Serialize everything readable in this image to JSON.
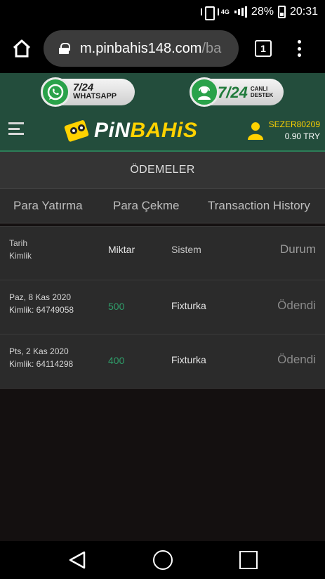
{
  "status_bar": {
    "network": "4G",
    "battery": "28%",
    "time": "20:31"
  },
  "browser": {
    "url_main": "m.pinbahis148.com",
    "url_rest": "/ba",
    "tab_count": "1"
  },
  "header": {
    "whatsapp": {
      "big": "7/24",
      "small": "WHATSAPP"
    },
    "live_support": {
      "big": "7/24",
      "line1": "CANLI",
      "line2": "DESTEK"
    },
    "logo": {
      "part1": "PiN",
      "part2": "BAHiS"
    },
    "user": {
      "name": "SEZER80209",
      "balance": "0.90 TRY"
    }
  },
  "page": {
    "title": "ÖDEMELER",
    "tabs": [
      {
        "label": "Para Yatırma"
      },
      {
        "label": "Para Çekme"
      },
      {
        "label": "Transaction History"
      }
    ]
  },
  "table": {
    "headers": {
      "date": "Tarih",
      "id": "Kimlik",
      "amount": "Miktar",
      "system": "Sistem",
      "status": "Durum"
    },
    "rows": [
      {
        "date": "Paz, 8 Kas 2020",
        "id": "Kimlik: 64749058",
        "amount": "500",
        "system": "Fixturka",
        "status": "Ödendi"
      },
      {
        "date": "Pts, 2 Kas 2020",
        "id": "Kimlik: 64114298",
        "amount": "400",
        "system": "Fixturka",
        "status": "Ödendi"
      }
    ]
  },
  "colors": {
    "header_bg": "#234d3c",
    "accent_yellow": "#ffd200",
    "amount_green": "#2f9e6a"
  },
  "icons": {
    "home": "home-icon",
    "lock": "lock-icon",
    "tabs": "tabs-icon",
    "menu": "more-vert-icon",
    "whatsapp": "whatsapp-icon",
    "support": "support-agent-icon",
    "hamburger": "hamburger-menu-icon",
    "user": "user-icon",
    "back": "back-triangle-icon",
    "home_nav": "home-circle-icon",
    "recents": "recents-square-icon"
  }
}
